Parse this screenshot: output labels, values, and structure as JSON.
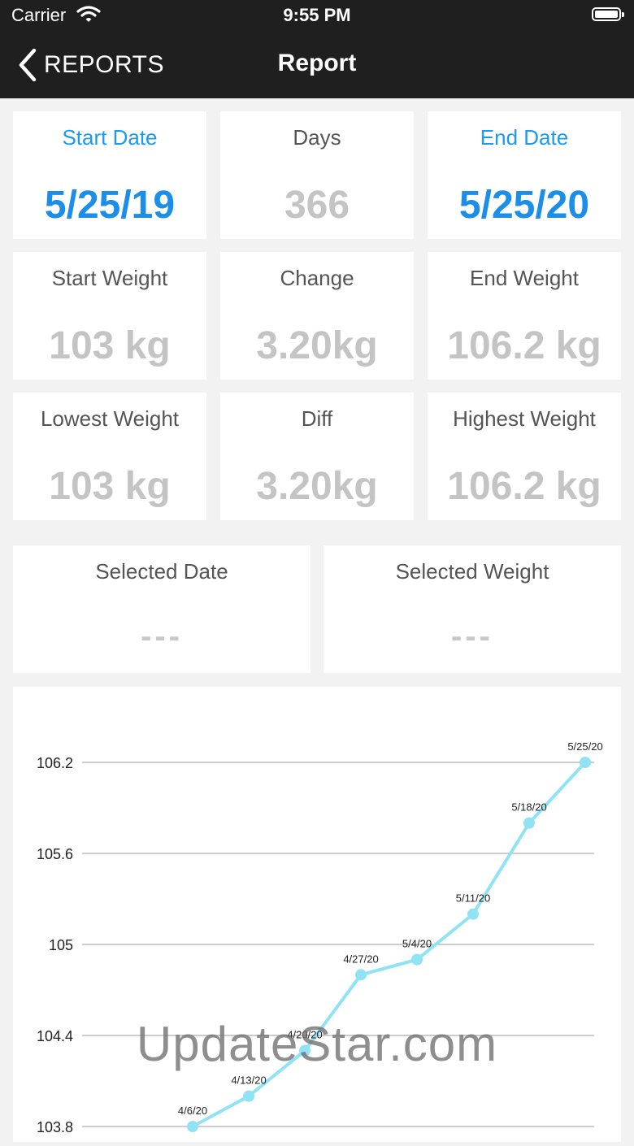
{
  "status_bar": {
    "carrier": "Carrier",
    "time": "9:55 PM"
  },
  "nav": {
    "back_label": "REPORTS",
    "title": "Report"
  },
  "summary": {
    "start_date": {
      "label": "Start Date",
      "value": "5/25/19"
    },
    "days": {
      "label": "Days",
      "value": "366"
    },
    "end_date": {
      "label": "End Date",
      "value": "5/25/20"
    },
    "start_weight": {
      "label": "Start Weight",
      "value": "103 kg"
    },
    "change": {
      "label": "Change",
      "value": "3.20kg"
    },
    "end_weight": {
      "label": "End Weight",
      "value": "106.2 kg"
    },
    "lowest_weight": {
      "label": "Lowest Weight",
      "value": "103 kg"
    },
    "diff": {
      "label": "Diff",
      "value": "3.20kg"
    },
    "highest_weight": {
      "label": "Highest Weight",
      "value": "106.2 kg"
    }
  },
  "selection": {
    "date": {
      "label": "Selected Date",
      "value": "---"
    },
    "weight": {
      "label": "Selected Weight",
      "value": "---"
    }
  },
  "chart_data": {
    "type": "line",
    "x": [
      "4/6/20",
      "4/13/20",
      "4/20/20",
      "4/27/20",
      "5/4/20",
      "5/11/20",
      "5/18/20",
      "5/25/20"
    ],
    "values": [
      103.8,
      104.0,
      104.3,
      104.8,
      104.9,
      105.2,
      105.8,
      106.2
    ],
    "y_ticks": [
      "106.2",
      "105.6",
      "105",
      "104.4",
      "103.8"
    ],
    "ylim": [
      103.8,
      106.2
    ],
    "grid": true,
    "line_color": "#8fe3f5",
    "point_color": "#8fe3f5"
  },
  "watermark": "UpdateStar.com",
  "colors": {
    "accent": "#1a9bf0",
    "nav_bg": "#1f1f1f",
    "muted_value": "#c4c4c4"
  }
}
